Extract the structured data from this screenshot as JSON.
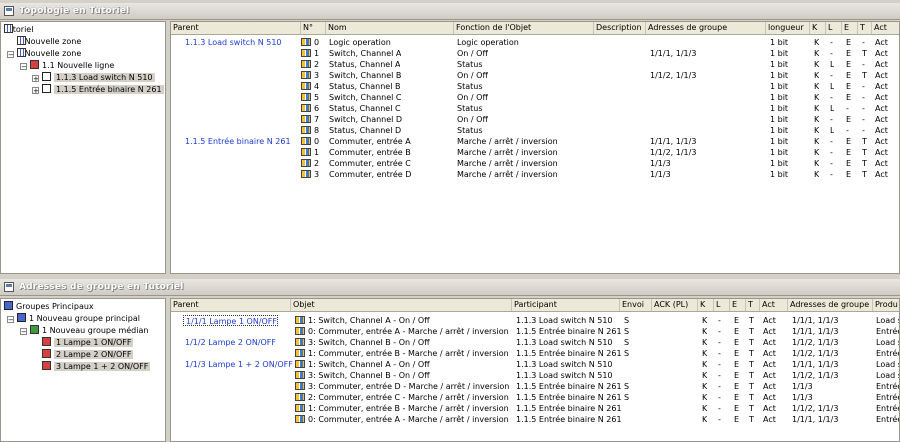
{
  "topology": {
    "title": "Topologie en Tutoriel",
    "tree": [
      {
        "label": "Tutoriel",
        "icon": "building-icon"
      },
      {
        "label": "0 Nouvelle zone",
        "icon": "zone-icon"
      },
      {
        "label": "1 Nouvelle zone",
        "icon": "zone-icon"
      },
      {
        "label": "1.1 Nouvelle ligne",
        "icon": "line-icon"
      },
      {
        "label": "1.1.3 Load switch N 510",
        "icon": "device-icon"
      },
      {
        "label": "1.1.5 Entrée binaire N 261",
        "icon": "device-icon"
      }
    ],
    "columns": [
      "Parent",
      "N°",
      "Nom",
      "Fonction de l'Objet",
      "Description",
      "Adresses de groupe",
      "longueur",
      "K",
      "L",
      "E",
      "T",
      "Act"
    ],
    "rows": [
      {
        "parent": "1.1.3 Load switch N 510",
        "num": "0",
        "name": "Logic operation",
        "func": "Logic operation",
        "desc": "",
        "addr": "",
        "len": "1 bit",
        "k": "K",
        "l": "-",
        "e": "E",
        "t": "-",
        "act": "Act"
      },
      {
        "parent": "",
        "num": "1",
        "name": "Switch, Channel A",
        "func": "On / Off",
        "desc": "",
        "addr": "1/1/1, 1/1/3",
        "len": "1 bit",
        "k": "K",
        "l": "-",
        "e": "E",
        "t": "T",
        "act": "Act"
      },
      {
        "parent": "",
        "num": "2",
        "name": "Status, Channel A",
        "func": "Status",
        "desc": "",
        "addr": "",
        "len": "1 bit",
        "k": "K",
        "l": "L",
        "e": "E",
        "t": "-",
        "act": "Act"
      },
      {
        "parent": "",
        "num": "3",
        "name": "Switch, Channel B",
        "func": "On / Off",
        "desc": "",
        "addr": "1/1/2, 1/1/3",
        "len": "1 bit",
        "k": "K",
        "l": "-",
        "e": "E",
        "t": "T",
        "act": "Act"
      },
      {
        "parent": "",
        "num": "4",
        "name": "Status, Channel B",
        "func": "Status",
        "desc": "",
        "addr": "",
        "len": "1 bit",
        "k": "K",
        "l": "L",
        "e": "E",
        "t": "-",
        "act": "Act"
      },
      {
        "parent": "",
        "num": "5",
        "name": "Switch, Channel C",
        "func": "On / Off",
        "desc": "",
        "addr": "",
        "len": "1 bit",
        "k": "K",
        "l": "-",
        "e": "E",
        "t": "-",
        "act": "Act"
      },
      {
        "parent": "",
        "num": "6",
        "name": "Status, Channel C",
        "func": "Status",
        "desc": "",
        "addr": "",
        "len": "1 bit",
        "k": "K",
        "l": "L",
        "e": "-",
        "t": "-",
        "act": "Act"
      },
      {
        "parent": "",
        "num": "7",
        "name": "Switch, Channel D",
        "func": "On / Off",
        "desc": "",
        "addr": "",
        "len": "1 bit",
        "k": "K",
        "l": "-",
        "e": "E",
        "t": "-",
        "act": "Act"
      },
      {
        "parent": "",
        "num": "8",
        "name": "Status, Channel D",
        "func": "Status",
        "desc": "",
        "addr": "",
        "len": "1 bit",
        "k": "K",
        "l": "L",
        "e": "-",
        "t": "-",
        "act": "Act"
      },
      {
        "parent": "1.1.5 Entrée binaire N 261",
        "num": "0",
        "name": "Commuter, entrée A",
        "func": "Marche / arrêt / inversion",
        "desc": "",
        "addr": "1/1/1, 1/1/3",
        "len": "1 bit",
        "k": "K",
        "l": "-",
        "e": "E",
        "t": "T",
        "act": "Act"
      },
      {
        "parent": "",
        "num": "1",
        "name": "Commuter, entrée B",
        "func": "Marche / arrêt / inversion",
        "desc": "",
        "addr": "1/1/2, 1/1/3",
        "len": "1 bit",
        "k": "K",
        "l": "-",
        "e": "E",
        "t": "T",
        "act": "Act"
      },
      {
        "parent": "",
        "num": "2",
        "name": "Commuter, entrée C",
        "func": "Marche / arrêt / inversion",
        "desc": "",
        "addr": "1/1/3",
        "len": "1 bit",
        "k": "K",
        "l": "-",
        "e": "E",
        "t": "T",
        "act": "Act"
      },
      {
        "parent": "",
        "num": "3",
        "name": "Commuter, entrée D",
        "func": "Marche / arrêt / inversion",
        "desc": "",
        "addr": "1/1/3",
        "len": "1 bit",
        "k": "K",
        "l": "-",
        "e": "E",
        "t": "T",
        "act": "Act"
      }
    ]
  },
  "groups": {
    "title": "Adresses de groupe en Tutoriel",
    "tree": [
      {
        "label": "Groupes Principaux",
        "icon": "groups-icon"
      },
      {
        "label": "1 Nouveau groupe principal",
        "icon": "main-group-icon"
      },
      {
        "label": "1 Nouveau groupe médian",
        "icon": "middle-group-icon"
      },
      {
        "label": "1 Lampe 1 ON/OFF",
        "icon": "group-address-icon"
      },
      {
        "label": "2 Lampe 2 ON/OFF",
        "icon": "group-address-icon"
      },
      {
        "label": "3 Lampe 1 + 2 ON/OFF",
        "icon": "group-address-icon"
      }
    ],
    "columns": [
      "Parent",
      "Objet",
      "Participant",
      "Envoi",
      "ACK (PL)",
      "K",
      "L",
      "E",
      "T",
      "Act",
      "Adresses de groupe",
      "Produ"
    ],
    "rows": [
      {
        "parent": "1/1/1 Lampe 1 ON/OFF",
        "obj": "1: Switch, Channel A - On / Off",
        "part": "1.1.3 Load switch N 510",
        "envoi": "S",
        "ack": "",
        "k": "K",
        "l": "-",
        "e": "E",
        "t": "T",
        "act": "Act",
        "addr": "1/1/1, 1/1/3",
        "prod": "Load sw"
      },
      {
        "parent": "",
        "obj": "0: Commuter, entrée A - Marche / arrêt / inversion",
        "part": "1.1.5 Entrée binaire N 261",
        "envoi": "S",
        "ack": "",
        "k": "K",
        "l": "-",
        "e": "E",
        "t": "T",
        "act": "Act",
        "addr": "1/1/1, 1/1/3",
        "prod": "Entrée"
      },
      {
        "parent": "1/1/2 Lampe 2 ON/OFF",
        "obj": "3: Switch, Channel B - On / Off",
        "part": "1.1.3 Load switch N 510",
        "envoi": "S",
        "ack": "",
        "k": "K",
        "l": "-",
        "e": "E",
        "t": "T",
        "act": "Act",
        "addr": "1/1/2, 1/1/3",
        "prod": "Load sw"
      },
      {
        "parent": "",
        "obj": "1: Commuter, entrée B - Marche / arrêt / inversion",
        "part": "1.1.5 Entrée binaire N 261",
        "envoi": "S",
        "ack": "",
        "k": "K",
        "l": "-",
        "e": "E",
        "t": "T",
        "act": "Act",
        "addr": "1/1/2, 1/1/3",
        "prod": "Entrée"
      },
      {
        "parent": "1/1/3 Lampe 1 + 2 ON/OFF",
        "obj": "1: Switch, Channel A - On / Off",
        "part": "1.1.3 Load switch N 510",
        "envoi": "",
        "ack": "",
        "k": "K",
        "l": "-",
        "e": "E",
        "t": "T",
        "act": "Act",
        "addr": "1/1/1, 1/1/3",
        "prod": "Load sw"
      },
      {
        "parent": "",
        "obj": "3: Switch, Channel B - On / Off",
        "part": "1.1.3 Load switch N 510",
        "envoi": "",
        "ack": "",
        "k": "K",
        "l": "-",
        "e": "E",
        "t": "T",
        "act": "Act",
        "addr": "1/1/2, 1/1/3",
        "prod": "Load sw"
      },
      {
        "parent": "",
        "obj": "3: Commuter, entrée D - Marche / arrêt / inversion",
        "part": "1.1.5 Entrée binaire N 261",
        "envoi": "S",
        "ack": "",
        "k": "K",
        "l": "-",
        "e": "E",
        "t": "T",
        "act": "Act",
        "addr": "1/1/3",
        "prod": "Entrée"
      },
      {
        "parent": "",
        "obj": "2: Commuter, entrée C - Marche / arrêt / inversion",
        "part": "1.1.5 Entrée binaire N 261",
        "envoi": "S",
        "ack": "",
        "k": "K",
        "l": "-",
        "e": "E",
        "t": "T",
        "act": "Act",
        "addr": "1/1/3",
        "prod": "Entrée"
      },
      {
        "parent": "",
        "obj": "1: Commuter, entrée B - Marche / arrêt / inversion",
        "part": "1.1.5 Entrée binaire N 261",
        "envoi": "",
        "ack": "",
        "k": "K",
        "l": "-",
        "e": "E",
        "t": "T",
        "act": "Act",
        "addr": "1/1/2, 1/1/3",
        "prod": "Entrée"
      },
      {
        "parent": "",
        "obj": "0: Commuter, entrée A - Marche / arrêt / inversion",
        "part": "1.1.5 Entrée binaire N 261",
        "envoi": "",
        "ack": "",
        "k": "K",
        "l": "-",
        "e": "E",
        "t": "T",
        "act": "Act",
        "addr": "1/1/1, 1/1/3",
        "prod": "Entrée"
      }
    ]
  }
}
